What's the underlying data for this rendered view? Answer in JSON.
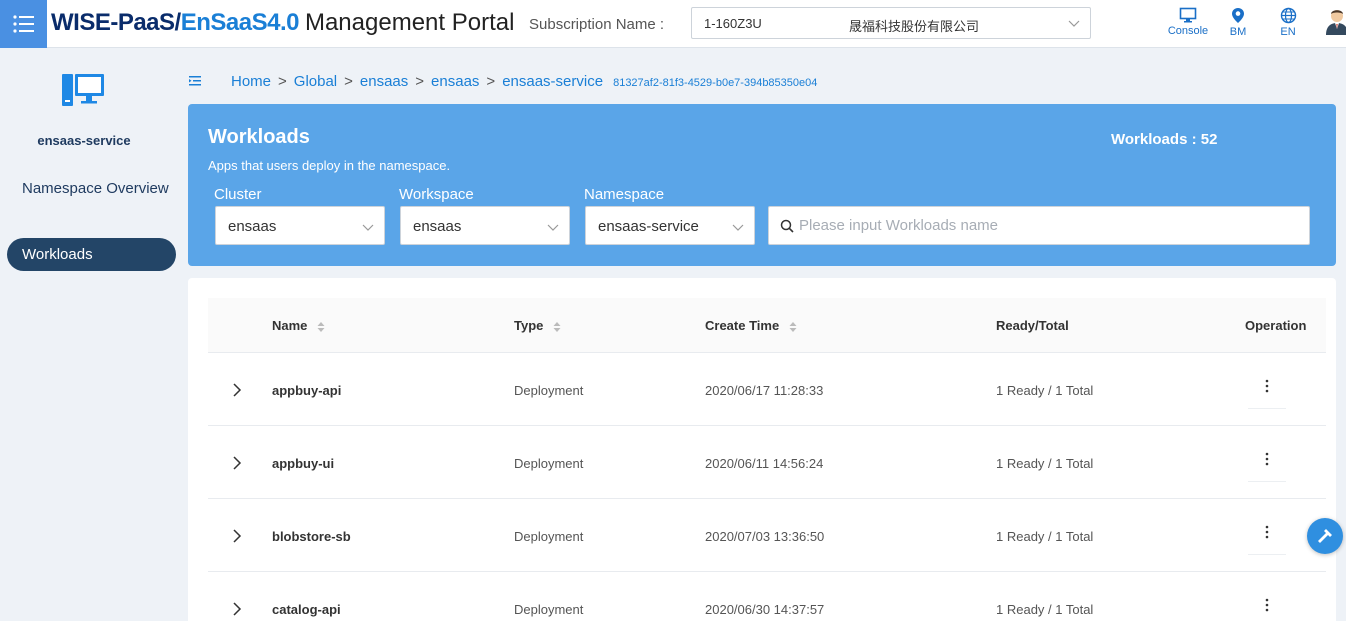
{
  "header": {
    "brand_part1": "WISE-PaaS/",
    "brand_part2": "EnSaaS4.0",
    "brand_part3": "Management Portal",
    "subscription_label": "Subscription Name :",
    "subscription_code": "1-160Z3U",
    "subscription_company": "晟福科技股份有限公司",
    "console_label": "Console",
    "bm_label": "BM",
    "lang_label": "EN"
  },
  "sidebar": {
    "service_name": "ensaas-service",
    "nav": [
      {
        "label": "Namespace Overview"
      },
      {
        "label": "Workloads"
      }
    ]
  },
  "breadcrumb": {
    "items": [
      "Home",
      "Global",
      "ensaas",
      "ensaas",
      "ensaas-service"
    ],
    "uuid": "81327af2-81f3-4529-b0e7-394b85350e04"
  },
  "banner": {
    "title": "Workloads",
    "description": "Apps that users deploy in the namespace.",
    "count_text": "Workloads : 52",
    "filters": {
      "cluster_label": "Cluster",
      "cluster_value": "ensaas",
      "workspace_label": "Workspace",
      "workspace_value": "ensaas",
      "namespace_label": "Namespace",
      "namespace_value": "ensaas-service"
    },
    "search_placeholder": "Please input Workloads name"
  },
  "table": {
    "columns": {
      "name": "Name",
      "type": "Type",
      "create_time": "Create Time",
      "ready_total": "Ready/Total",
      "operation": "Operation"
    },
    "rows": [
      {
        "name": "appbuy-api",
        "type": "Deployment",
        "create_time": "2020/06/17 11:28:33",
        "ready": "1 Ready / 1 Total"
      },
      {
        "name": "appbuy-ui",
        "type": "Deployment",
        "create_time": "2020/06/11 14:56:24",
        "ready": "1 Ready / 1 Total"
      },
      {
        "name": "blobstore-sb",
        "type": "Deployment",
        "create_time": "2020/07/03 13:36:50",
        "ready": "1 Ready / 1 Total"
      },
      {
        "name": "catalog-api",
        "type": "Deployment",
        "create_time": "2020/06/30 14:37:57",
        "ready": "1 Ready / 1 Total"
      }
    ]
  },
  "colors": {
    "accent": "#4a90e2",
    "banner": "#5aa5e8",
    "nav_active": "#234567",
    "link": "#1a7fd6"
  }
}
